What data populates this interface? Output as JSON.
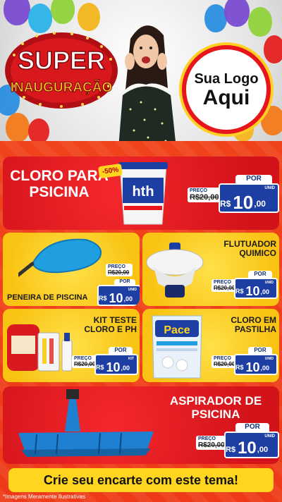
{
  "hero": {
    "badge_line1": "SUPER",
    "badge_line2": "INAUGURAÇÃO",
    "logo_line1": "Sua Logo",
    "logo_line2": "Aqui"
  },
  "products": [
    {
      "title": "CLORO PARA PSICINA",
      "discount": "-50%",
      "brand": "hth",
      "preco_label": "PREÇO",
      "old_price": "R$20,00",
      "por_label": "POR",
      "currency": "R$",
      "price_int": "10",
      "price_cents": ",00",
      "unit": "UNID"
    },
    {
      "title": "PENEIRA DE PISCINA",
      "preco_label": "PREÇO",
      "old_price": "R$20,00",
      "por_label": "POR",
      "currency": "R$",
      "price_int": "10",
      "price_cents": ",00",
      "unit": "UNID"
    },
    {
      "title": "FLUTUADOR QUIMICO",
      "preco_label": "PREÇO",
      "old_price": "R$20,00",
      "por_label": "POR",
      "currency": "R$",
      "price_int": "10",
      "price_cents": ",00",
      "unit": "UNID"
    },
    {
      "title": "KIT TESTE CLORO E PH",
      "preco_label": "PREÇO",
      "old_price": "R$20,00",
      "por_label": "POR",
      "currency": "R$",
      "price_int": "10",
      "price_cents": ",00",
      "unit": "KIT"
    },
    {
      "title": "CLORO EM PASTILHA",
      "brand": "Pace",
      "preco_label": "PREÇO",
      "old_price": "R$20,00",
      "por_label": "POR",
      "currency": "R$",
      "price_int": "10",
      "price_cents": ",00",
      "unit": "UNID"
    },
    {
      "title": "ASPIRADOR DE PSICINA",
      "preco_label": "PREÇO",
      "old_price": "R$20,00",
      "por_label": "POR",
      "currency": "R$",
      "price_int": "10",
      "price_cents": ",00",
      "unit": "UNID"
    }
  ],
  "footer": {
    "cta": "Crie seu encarte com este tema!",
    "note": "*Imagens Meramente Ilustrativas"
  },
  "colors": {
    "accent_red": "#e8151c",
    "accent_yellow": "#ffd51f",
    "price_blue": "#1d3ea3"
  }
}
